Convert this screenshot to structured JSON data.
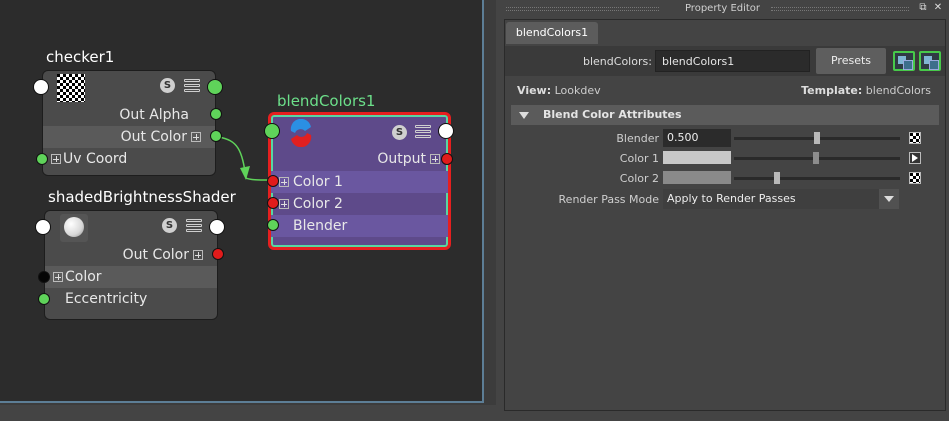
{
  "node_editor": {
    "nodes": {
      "checker": {
        "title": "checker1",
        "attrs": [
          "Out Alpha",
          "Out Color",
          "Uv Coord"
        ]
      },
      "shaded": {
        "title": "shadedBrightnessShader",
        "attrs": [
          "Out Color",
          "Color",
          "Eccentricity"
        ]
      },
      "blend": {
        "title": "blendColors1",
        "attrs": [
          "Output",
          "Color 1",
          "Color 2",
          "Blender"
        ]
      }
    },
    "s_badge": "S"
  },
  "property_editor": {
    "window_title": "Property Editor",
    "tab": "blendColors1",
    "node_type_label": "blendColors:",
    "node_name_value": "blendColors1",
    "presets_label": "Presets",
    "view_label": "View:",
    "view_value": "Lookdev",
    "template_label": "Template:",
    "template_value": "blendColors",
    "section_title": "Blend Color Attributes",
    "attributes": {
      "blender_label": "Blender",
      "blender_value": "0.500",
      "blender_fraction": 0.5,
      "color1_label": "Color 1",
      "color1_hex": "#c8c8c8",
      "color2_label": "Color 2",
      "color2_hex": "#8a8a8a",
      "render_pass_label": "Render Pass Mode",
      "render_pass_value": "Apply to Render Passes"
    }
  },
  "colors": {
    "selected_outline": "#e61f1f",
    "selected_fill": "#5e4a8a",
    "port_green": "#5fd35a",
    "port_red": "#e11b1b",
    "selected_title": "#6ce08a"
  }
}
